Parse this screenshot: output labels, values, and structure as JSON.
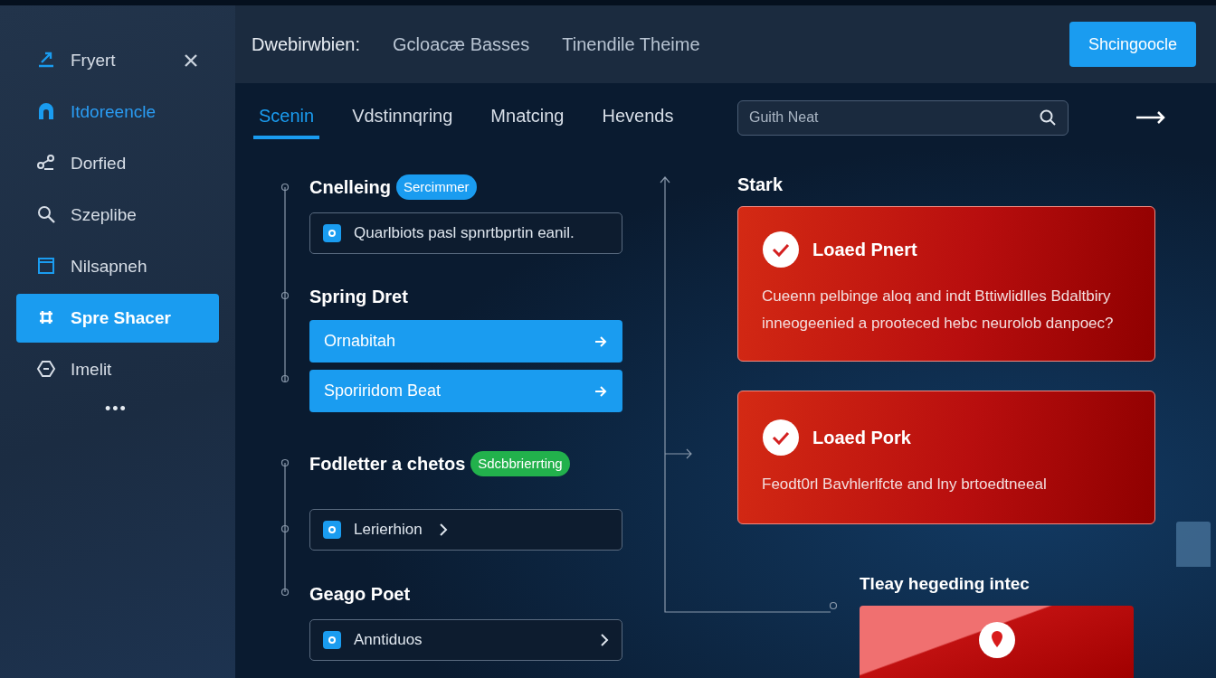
{
  "sidebar": {
    "items": [
      {
        "label": "Fryert",
        "selected": false,
        "highlighted": false,
        "closable": true
      },
      {
        "label": "Itdoreencle",
        "selected": false,
        "highlighted": true,
        "closable": false
      },
      {
        "label": "Dorfied",
        "selected": false,
        "highlighted": false,
        "closable": false
      },
      {
        "label": "Szeplibe",
        "selected": false,
        "highlighted": false,
        "closable": false
      },
      {
        "label": "Nilsapneh",
        "selected": false,
        "highlighted": false,
        "closable": false
      },
      {
        "label": "Spre Shacer",
        "selected": true,
        "highlighted": false,
        "closable": false
      },
      {
        "label": "Imelit",
        "selected": false,
        "highlighted": false,
        "closable": false
      }
    ],
    "more": "•••"
  },
  "header": {
    "breadcrumb": [
      "Dwebirwbien:",
      "Gcloacæ Basses",
      "Tinendile Theime"
    ],
    "button": "Shcingoocle"
  },
  "tabs": [
    {
      "label": "Scenin",
      "selected": true
    },
    {
      "label": "Vdstinnqring",
      "selected": false
    },
    {
      "label": "Mnatcing",
      "selected": false
    },
    {
      "label": "Hevends",
      "selected": false
    }
  ],
  "search": {
    "placeholder": "Guith Neat"
  },
  "timeline": [
    {
      "title": "Cnelleing",
      "badge": {
        "text": "Sercimmer",
        "color": "#1a9cf0"
      },
      "items": [
        {
          "kind": "note",
          "label": "Quarlbiots pasl spnrtbprtin eanil.",
          "checked": true
        }
      ]
    },
    {
      "title": "Spring Dret",
      "items": [
        {
          "kind": "action",
          "label": "Ornabitah"
        },
        {
          "kind": "action",
          "label": "Sporiridom Beat"
        }
      ]
    },
    {
      "title": "Fodletter a chetos",
      "badge": {
        "text": "Sdcbbrierrting",
        "color": "#22b14c"
      },
      "items": [
        {
          "kind": "link",
          "label": "Lerierhion",
          "checked": true
        }
      ]
    },
    {
      "title": "Geago Poet",
      "items": [
        {
          "kind": "row",
          "label": "Anntiduos",
          "checked": true
        }
      ]
    }
  ],
  "alerts": {
    "title": "Stark",
    "cards": [
      {
        "title": "Loaed Pnert",
        "body": "Cueenn pelbinge aloq and indt Bttiwlidlles Bdaltbiry inneogeenied a prooteced hebc neurolob danpoec?"
      },
      {
        "title": "Loaed Pork",
        "body": "Feodt0rl Bavhlerlfcte and lny brtoedtneeal"
      }
    ]
  },
  "next_section": {
    "title": "Tleay hegeding intec"
  }
}
